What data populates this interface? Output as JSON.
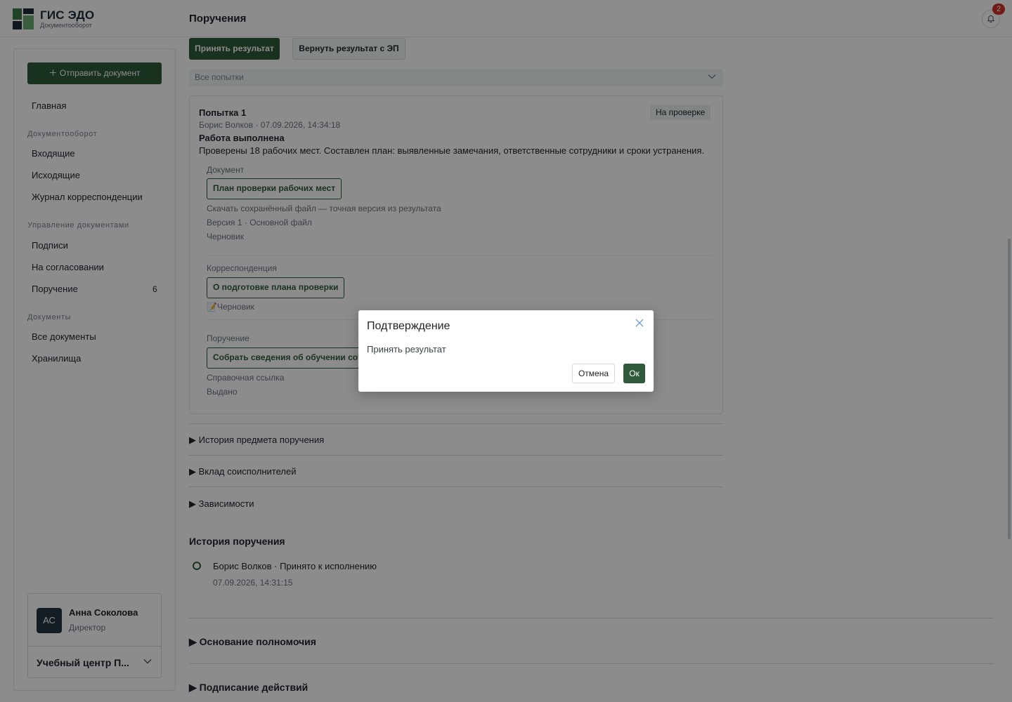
{
  "brand": {
    "title": "ГИС ЭДО",
    "subtitle": "Документооборот"
  },
  "header": {
    "page_title": "Поручения",
    "notification_count": "2"
  },
  "sidebar": {
    "send_button": "＋ Отправить документ",
    "home": "Главная",
    "groups": {
      "docflow": "Документооборот",
      "management": "Управление документами",
      "documents": "Документы"
    },
    "items": {
      "incoming": "Входящие",
      "outgoing": "Исходящие",
      "journal": "Журнал корреспонденции",
      "signatures": "Подписи",
      "approval": "На согласовании",
      "assignment": "Поручение",
      "assignment_count": "6",
      "all_documents": "Все документы",
      "storages": "Хранилища"
    },
    "user": {
      "initials": "АС",
      "name": "Анна Соколова",
      "role": "Директор",
      "org": "Учебный центр П..."
    }
  },
  "actions": {
    "accept": "Принять результат",
    "return_with_sign": "Вернуть результат с ЭП"
  },
  "attempt_filter": {
    "value": "Все попытки"
  },
  "attempt": {
    "title": "Попытка 1",
    "meta": "Борис Волков · 07.09.2026, 14:34:18",
    "status": "На проверке",
    "heading": "Работа выполнена",
    "text": "Проверены 18 рабочих мест. Составлен план: выявленные замечания, ответственные сотрудники и сроки устранения.",
    "document": {
      "label": "Документ",
      "link": "План проверки рабочих мест",
      "download": "Скачать сохранённый файл — точная версия из результата",
      "version": "Версия 1 · Основной файл",
      "state": "Черновик"
    },
    "correspondence": {
      "label": "Корреспонденция",
      "link": "О подготовке плана проверки",
      "state": "📝Черновик"
    },
    "assignment": {
      "label": "Поручение",
      "link": "Собрать сведения об обучении сотрудников",
      "ref": "Справочная ссылка",
      "state": "Выдано"
    }
  },
  "collapsibles": {
    "subject_history": "▶ История предмета поручения",
    "contributions": "▶ Вклад соисполнителей",
    "dependencies": "▶ Зависимости"
  },
  "history": {
    "title": "История поручения",
    "entry": "Борис Волков · Принято к исполнению",
    "time": "07.09.2026, 14:31:15"
  },
  "bottom_sections": {
    "authority": "▶ Основание полномочия",
    "signing": "▶ Подписание действий"
  },
  "modal": {
    "title": "Подтверждение",
    "body": "Принять результат",
    "cancel": "Отмена",
    "ok": "Ок"
  },
  "colors": {
    "accent": "#2e5a3a",
    "badge": "#d0302a"
  }
}
